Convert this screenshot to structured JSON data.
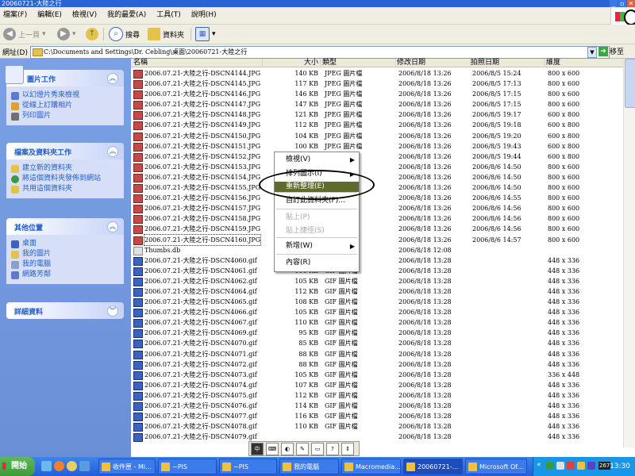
{
  "window": {
    "title": "20060721-大陸之行"
  },
  "menubar": {
    "items": [
      "檔案(F)",
      "編輯(E)",
      "檢視(V)",
      "我的最愛(A)",
      "工具(T)",
      "說明(H)"
    ]
  },
  "toolbar": {
    "back": "上一頁",
    "search": "搜尋",
    "folders": "資料夾"
  },
  "address": {
    "label": "網址(D)",
    "path": "C:\\Documents and Settings\\Dr. Cebling\\桌面\\20060721-大陸之行",
    "go": "移至"
  },
  "taskpane": {
    "picture_tasks": {
      "title": "圖片工作",
      "items": [
        "以幻燈片秀來檢視",
        "從線上訂購相片",
        "列印圖片"
      ]
    },
    "file_tasks": {
      "title": "檔案及資料夾工作",
      "items": [
        "建立新的資料夾",
        "將這個資料夾發佈到網站",
        "共用這個資料夾"
      ]
    },
    "other_places": {
      "title": "其他位置",
      "items": [
        "桌面",
        "我的圖片",
        "我的電腦",
        "網路芳鄰"
      ]
    },
    "details": {
      "title": "詳細資料"
    }
  },
  "list": {
    "columns": [
      "名稱",
      "大小",
      "類型",
      "修改日期",
      "拍照日期",
      "維度"
    ],
    "rows": [
      {
        "name": "2006.07.21-大陸之行-DSCN4144.JPG",
        "size": "140 KB",
        "type": "JPEG 圖片檔",
        "modified": "2006/8/18 13:26",
        "taken": "2006/8/5 15:24",
        "dim": "800 x 600",
        "kind": "jpg"
      },
      {
        "name": "2006.07.21-大陸之行-DSCN4145.JPG",
        "size": "117 KB",
        "type": "JPEG 圖片檔",
        "modified": "2006/8/18 13:26",
        "taken": "2006/8/5 17:13",
        "dim": "800 x 600",
        "kind": "jpg"
      },
      {
        "name": "2006.07.21-大陸之行-DSCN4146.JPG",
        "size": "146 KB",
        "type": "JPEG 圖片檔",
        "modified": "2006/8/18 13:26",
        "taken": "2006/8/5 17:15",
        "dim": "800 x 600",
        "kind": "jpg"
      },
      {
        "name": "2006.07.21-大陸之行-DSCN4147.JPG",
        "size": "147 KB",
        "type": "JPEG 圖片檔",
        "modified": "2006/8/18 13:26",
        "taken": "2006/8/5 17:15",
        "dim": "800 x 600",
        "kind": "jpg"
      },
      {
        "name": "2006.07.21-大陸之行-DSCN4148.JPG",
        "size": "121 KB",
        "type": "JPEG 圖片檔",
        "modified": "2006/8/18 13:26",
        "taken": "2006/8/5 19:17",
        "dim": "600 x 800",
        "kind": "jpg"
      },
      {
        "name": "2006.07.21-大陸之行-DSCN4149.JPG",
        "size": "112 KB",
        "type": "JPEG 圖片檔",
        "modified": "2006/8/18 13:26",
        "taken": "2006/8/5 19:18",
        "dim": "600 x 800",
        "kind": "jpg"
      },
      {
        "name": "2006.07.21-大陸之行-DSCN4150.JPG",
        "size": "104 KB",
        "type": "JPEG 圖片檔",
        "modified": "2006/8/18 13:26",
        "taken": "2006/8/5 19:20",
        "dim": "600 x 800",
        "kind": "jpg"
      },
      {
        "name": "2006.07.21-大陸之行-DSCN4151.JPG",
        "size": "100 KB",
        "type": "JPEG 圖片檔",
        "modified": "2006/8/18 13:26",
        "taken": "2006/8/5 19:43",
        "dim": "600 x 800",
        "kind": "jpg"
      },
      {
        "name": "2006.07.21-大陸之行-DSCN4152.JPG",
        "size": "",
        "type": "",
        "modified": "2006/8/18 13:26",
        "taken": "2006/8/5 19:44",
        "dim": "600 x 800",
        "kind": "jpg"
      },
      {
        "name": "2006.07.21-大陸之行-DSCN4153.JPG",
        "size": "",
        "type": "",
        "modified": "2006/8/18 13:26",
        "taken": "2006/8/6 14:50",
        "dim": "800 x 600",
        "kind": "jpg"
      },
      {
        "name": "2006.07.21-大陸之行-DSCN4154.JPG",
        "size": "",
        "type": "",
        "modified": "2006/8/18 13:26",
        "taken": "2006/8/6 14:50",
        "dim": "800 x 600",
        "kind": "jpg"
      },
      {
        "name": "2006.07.21-大陸之行-DSCN4155.JPG",
        "size": "",
        "type": "",
        "modified": "2006/8/18 13:26",
        "taken": "2006/8/6 14:50",
        "dim": "800 x 600",
        "kind": "jpg"
      },
      {
        "name": "2006.07.21-大陸之行-DSCN4156.JPG",
        "size": "",
        "type": "",
        "modified": "2006/8/18 13:26",
        "taken": "2006/8/6 14:55",
        "dim": "800 x 600",
        "kind": "jpg"
      },
      {
        "name": "2006.07.21-大陸之行-DSCN4157.JPG",
        "size": "",
        "type": "",
        "modified": "2006/8/18 13:26",
        "taken": "2006/8/6 14:56",
        "dim": "800 x 600",
        "kind": "jpg"
      },
      {
        "name": "2006.07.21-大陸之行-DSCN4158.JPG",
        "size": "",
        "type": "",
        "modified": "2006/8/18 13:26",
        "taken": "2006/8/6 14:56",
        "dim": "800 x 600",
        "kind": "jpg"
      },
      {
        "name": "2006.07.21-大陸之行-DSCN4159.JPG",
        "size": "",
        "type": "",
        "modified": "2006/8/18 13:26",
        "taken": "2006/8/6 14:56",
        "dim": "800 x 600",
        "kind": "jpg"
      },
      {
        "name": "2006.07.21-大陸之行-DSCN4160.JPG",
        "size": "",
        "type": "",
        "modified": "2006/8/18 13:26",
        "taken": "2006/8/6 14:57",
        "dim": "800 x 600",
        "kind": "jpg",
        "selected": true
      },
      {
        "name": "Thumbs.db",
        "size": "",
        "type": "",
        "modified": "2006/8/18 12:08",
        "taken": "",
        "dim": "",
        "kind": "db"
      },
      {
        "name": "2006.07.21-大陸之行-DSCN4060.gif",
        "size": "",
        "type": "",
        "modified": "2006/8/18 13:28",
        "taken": "",
        "dim": "448 x 336",
        "kind": "gif"
      },
      {
        "name": "2006.07.21-大陸之行-DSCN4061.gif",
        "size": "110 KB",
        "type": "GIF 圖片檔",
        "modified": "2006/8/18 13:28",
        "taken": "",
        "dim": "448 x 336",
        "kind": "gif"
      },
      {
        "name": "2006.07.21-大陸之行-DSCN4062.gif",
        "size": "105 KB",
        "type": "GIF 圖片檔",
        "modified": "2006/8/18 13:28",
        "taken": "",
        "dim": "448 x 336",
        "kind": "gif"
      },
      {
        "name": "2006.07.21-大陸之行-DSCN4064.gif",
        "size": "112 KB",
        "type": "GIF 圖片檔",
        "modified": "2006/8/18 13:28",
        "taken": "",
        "dim": "448 x 336",
        "kind": "gif"
      },
      {
        "name": "2006.07.21-大陸之行-DSCN4065.gif",
        "size": "108 KB",
        "type": "GIF 圖片檔",
        "modified": "2006/8/18 13:28",
        "taken": "",
        "dim": "448 x 336",
        "kind": "gif"
      },
      {
        "name": "2006.07.21-大陸之行-DSCN4066.gif",
        "size": "105 KB",
        "type": "GIF 圖片檔",
        "modified": "2006/8/18 13:28",
        "taken": "",
        "dim": "448 x 336",
        "kind": "gif"
      },
      {
        "name": "2006.07.21-大陸之行-DSCN4067.gif",
        "size": "110 KB",
        "type": "GIF 圖片檔",
        "modified": "2006/8/18 13:28",
        "taken": "",
        "dim": "448 x 336",
        "kind": "gif"
      },
      {
        "name": "2006.07.21-大陸之行-DSCN4069.gif",
        "size": "95 KB",
        "type": "GIF 圖片檔",
        "modified": "2006/8/18 13:28",
        "taken": "",
        "dim": "448 x 336",
        "kind": "gif"
      },
      {
        "name": "2006.07.21-大陸之行-DSCN4070.gif",
        "size": "85 KB",
        "type": "GIF 圖片檔",
        "modified": "2006/8/18 13:28",
        "taken": "",
        "dim": "448 x 336",
        "kind": "gif"
      },
      {
        "name": "2006.07.21-大陸之行-DSCN4071.gif",
        "size": "88 KB",
        "type": "GIF 圖片檔",
        "modified": "2006/8/18 13:28",
        "taken": "",
        "dim": "448 x 336",
        "kind": "gif"
      },
      {
        "name": "2006.07.21-大陸之行-DSCN4072.gif",
        "size": "88 KB",
        "type": "GIF 圖片檔",
        "modified": "2006/8/18 13:28",
        "taken": "",
        "dim": "448 x 336",
        "kind": "gif"
      },
      {
        "name": "2006.07.21-大陸之行-DSCN4073.gif",
        "size": "105 KB",
        "type": "GIF 圖片檔",
        "modified": "2006/8/18 13:28",
        "taken": "",
        "dim": "336 x 448",
        "kind": "gif"
      },
      {
        "name": "2006.07.21-大陸之行-DSCN4074.gif",
        "size": "107 KB",
        "type": "GIF 圖片檔",
        "modified": "2006/8/18 13:28",
        "taken": "",
        "dim": "448 x 336",
        "kind": "gif"
      },
      {
        "name": "2006.07.21-大陸之行-DSCN4075.gif",
        "size": "112 KB",
        "type": "GIF 圖片檔",
        "modified": "2006/8/18 13:28",
        "taken": "",
        "dim": "448 x 336",
        "kind": "gif"
      },
      {
        "name": "2006.07.21-大陸之行-DSCN4076.gif",
        "size": "114 KB",
        "type": "GIF 圖片檔",
        "modified": "2006/8/18 13:28",
        "taken": "",
        "dim": "448 x 336",
        "kind": "gif"
      },
      {
        "name": "2006.07.21-大陸之行-DSCN4077.gif",
        "size": "116 KB",
        "type": "GIF 圖片檔",
        "modified": "2006/8/18 13:28",
        "taken": "",
        "dim": "448 x 336",
        "kind": "gif"
      },
      {
        "name": "2006.07.21-大陸之行-DSCN4078.gif",
        "size": "110 KB",
        "type": "GIF 圖片檔",
        "modified": "2006/8/18 13:28",
        "taken": "",
        "dim": "448 x 336",
        "kind": "gif"
      },
      {
        "name": "2006.07.21-大陸之行-DSCN4079.gif",
        "size": "",
        "type": "",
        "modified": "2006/8/18 13:28",
        "taken": "",
        "dim": "448 x 336",
        "kind": "gif"
      }
    ]
  },
  "context_menu": {
    "items": [
      {
        "label": "檢視(V)",
        "submenu": true,
        "disabled": false,
        "highlight": false
      },
      {
        "label": "排列圖示(I)",
        "submenu": true,
        "disabled": false,
        "highlight": false
      },
      {
        "label": "重新整理(E)",
        "submenu": false,
        "disabled": false,
        "highlight": true
      },
      {
        "label": "自訂此資料夾(F)...",
        "submenu": false,
        "disabled": false,
        "highlight": false
      },
      {
        "label": "貼上(P)",
        "submenu": false,
        "disabled": true,
        "highlight": false
      },
      {
        "label": "貼上捷徑(S)",
        "submenu": false,
        "disabled": true,
        "highlight": false
      },
      {
        "label": "新增(W)",
        "submenu": true,
        "disabled": false,
        "highlight": false
      },
      {
        "label": "內容(R)",
        "submenu": false,
        "disabled": false,
        "highlight": false
      }
    ]
  },
  "ime": {
    "mode": "中"
  },
  "taskbar": {
    "start": "開始",
    "buttons": [
      {
        "label": "收件匣 - Mi...",
        "active": false
      },
      {
        "label": "~PIS",
        "active": false
      },
      {
        "label": "~PIS",
        "active": false
      },
      {
        "label": "我的電腦",
        "active": false
      },
      {
        "label": "Macromedia...",
        "active": false
      },
      {
        "label": "20060721-...",
        "active": true
      },
      {
        "label": "Microsoft Of...",
        "active": false
      }
    ],
    "clock": "13:30",
    "tray_badge": "267"
  },
  "colors": {
    "titlebar": "#2a63d6",
    "taskpane": "#6b8fd7",
    "menu_highlight": "#5f6b2c",
    "taskbar": "#245edb",
    "start_button": "#3d9a38"
  }
}
